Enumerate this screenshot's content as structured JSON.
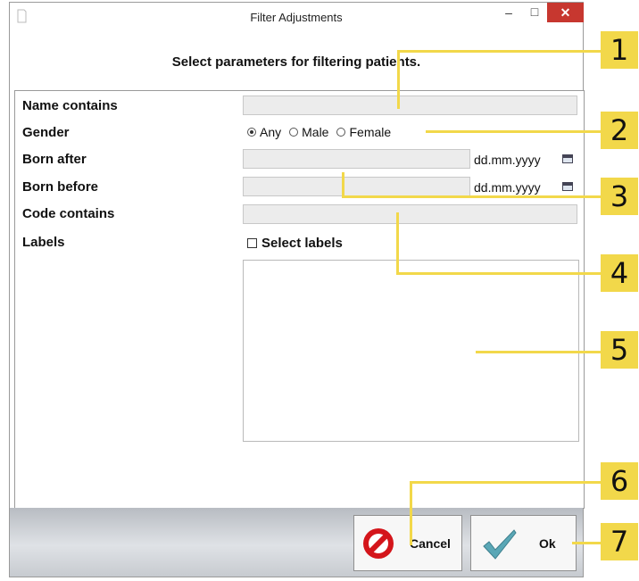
{
  "window": {
    "title": "Filter Adjustments",
    "minimize_glyph": "–",
    "maximize_glyph": "□",
    "close_glyph": "✕"
  },
  "heading": "Select parameters for filtering patients.",
  "form": {
    "name_label": "Name contains",
    "gender_label": "Gender",
    "gender_options": [
      {
        "label": "Any",
        "selected": true
      },
      {
        "label": "Male",
        "selected": false
      },
      {
        "label": "Female",
        "selected": false
      }
    ],
    "born_after_label": "Born after",
    "born_before_label": "Born before",
    "date_format": "dd.mm.yyyy",
    "code_label": "Code contains",
    "labels_label": "Labels",
    "select_labels": "Select labels",
    "select_labels_checked": false
  },
  "buttons": {
    "cancel": "Cancel",
    "ok": "Ok"
  },
  "callouts": [
    "1",
    "2",
    "3",
    "4",
    "5",
    "6",
    "7"
  ],
  "colors": {
    "callout": "#f2d84a",
    "close_button": "#c7372f",
    "cancel_icon": "#d4151b",
    "ok_check": "#5aa7b6"
  },
  "icons": [
    "app-icon",
    "calendar-icon",
    "cancel-icon",
    "checkmark-icon"
  ]
}
